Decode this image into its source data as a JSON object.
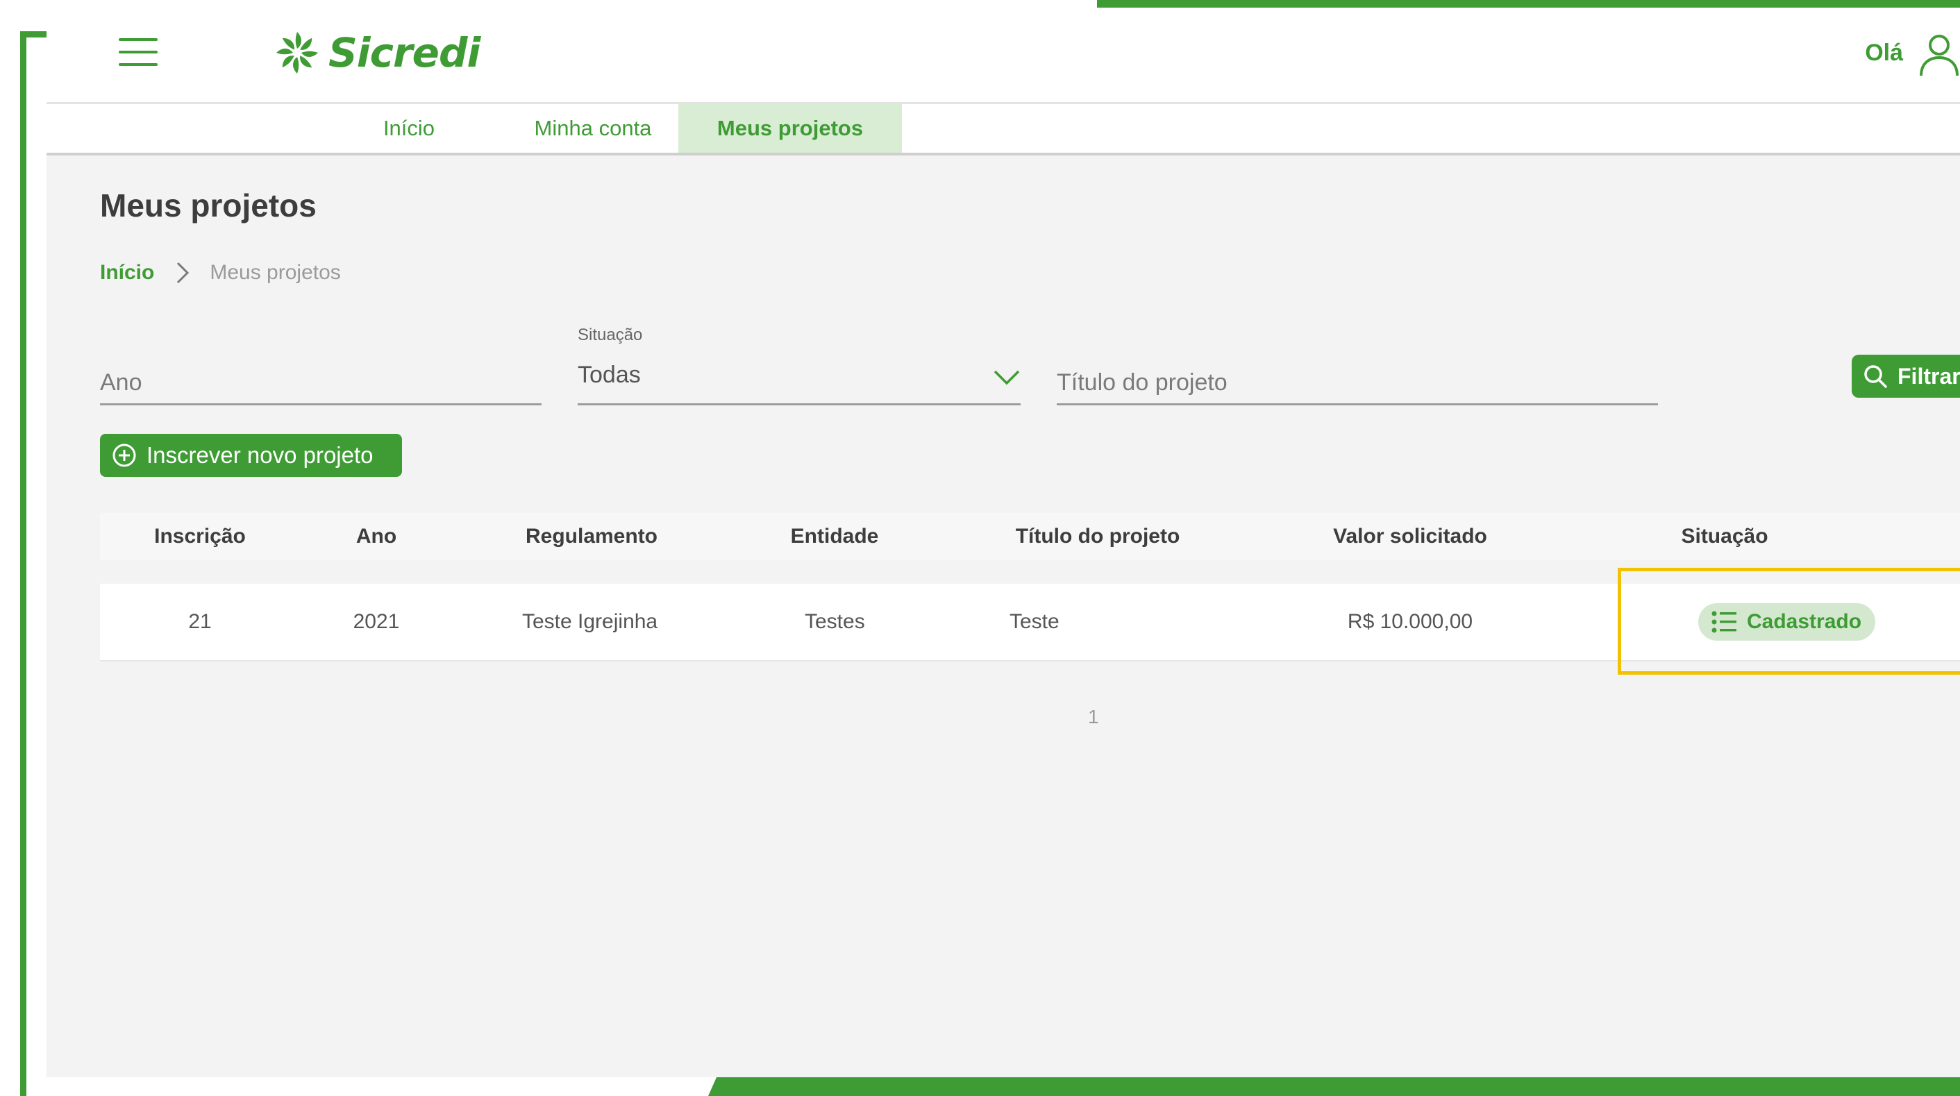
{
  "header": {
    "logo_text": "Sicredi",
    "greeting": "Olá"
  },
  "nav": {
    "tabs": [
      {
        "label": "Início"
      },
      {
        "label": "Minha conta"
      },
      {
        "label": "Meus projetos",
        "active": true
      }
    ]
  },
  "page": {
    "title": "Meus projetos",
    "breadcrumb": {
      "home": "Início",
      "current": "Meus projetos"
    }
  },
  "filters": {
    "ano": {
      "placeholder": "Ano"
    },
    "situacao": {
      "label": "Situação",
      "value": "Todas"
    },
    "titulo": {
      "placeholder": "Título do projeto"
    },
    "filter_button": "Filtrar"
  },
  "actions": {
    "new_project": "Inscrever novo projeto"
  },
  "table": {
    "headers": [
      "Inscrição",
      "Ano",
      "Regulamento",
      "Entidade",
      "Título do projeto",
      "Valor solicitado",
      "Situação"
    ],
    "rows": [
      {
        "inscricao": "21",
        "ano": "2021",
        "regulamento": "Teste Igrejinha",
        "entidade": "Testes",
        "titulo": "Teste",
        "valor": "R$ 10.000,00",
        "situacao": "Cadastrado"
      }
    ]
  },
  "pagination": {
    "current_page": "1"
  },
  "colors": {
    "brand_green": "#3f9c35",
    "active_tab_bg": "#d9ecd4",
    "highlight_yellow": "#f2c200"
  }
}
